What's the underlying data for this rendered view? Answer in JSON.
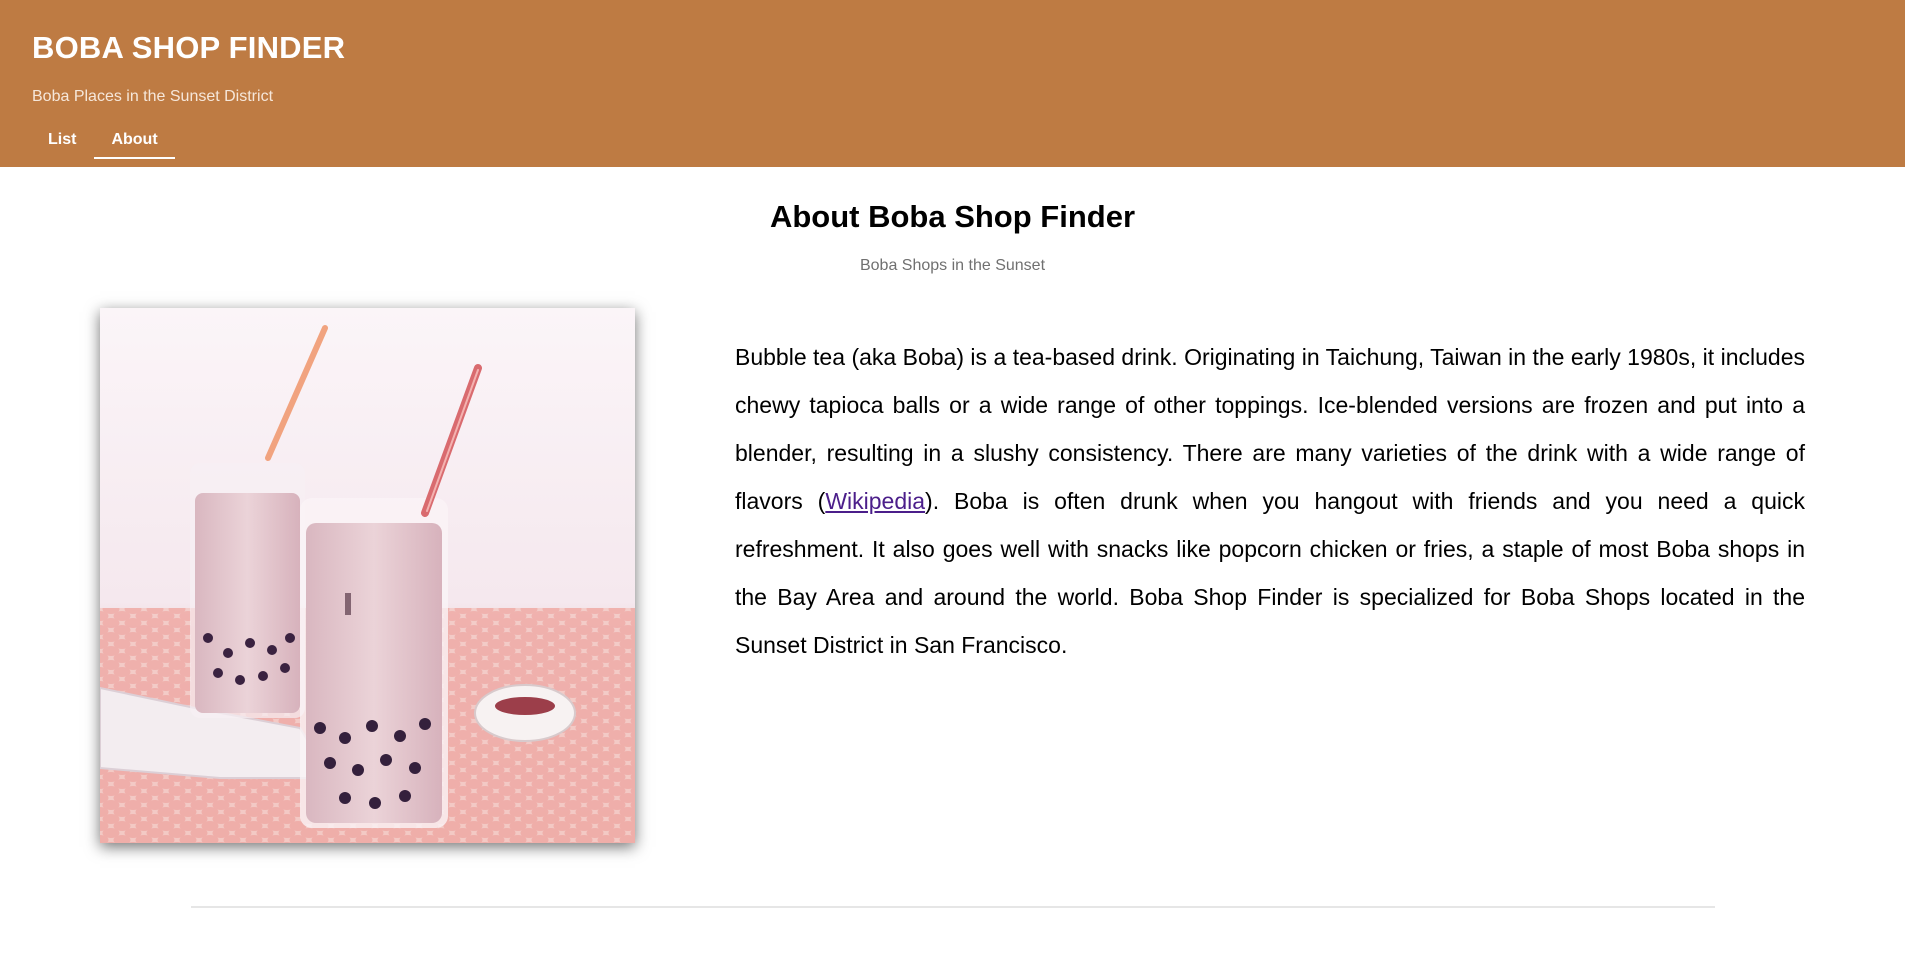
{
  "header": {
    "title": "BOBA SHOP FINDER",
    "subtitle": "Boba Places in the Sunset District",
    "background_color": "#BE7B43"
  },
  "nav": {
    "tabs": [
      {
        "label": "List",
        "active": false
      },
      {
        "label": "About",
        "active": true
      }
    ]
  },
  "main": {
    "title": "About Boba Shop Finder",
    "subtitle": "Boba Shops in the Sunset",
    "image_subject": "two-glasses-of-pink-bubble-tea",
    "paragraph": {
      "before_link": "Bubble tea (aka Boba) is a tea-based drink. Originating in Taichung, Taiwan in the early 1980s, it includes chewy tapioca balls or a wide range of other toppings. Ice-blended versions are frozen and put into a blender, resulting in a slushy consistency. There are many varieties of the drink with a wide range of flavors (",
      "link_text": "Wikipedia",
      "after_link": "). Boba is often drunk when you hangout with friends and you need a quick refreshment. It also goes well with snacks like popcorn chicken or fries, a staple of most Boba shops in the Bay Area and around the world. Boba Shop Finder is specialized for Boba Shops located in the Sunset District in San Francisco."
    },
    "link_color": "#4B1E8A"
  }
}
